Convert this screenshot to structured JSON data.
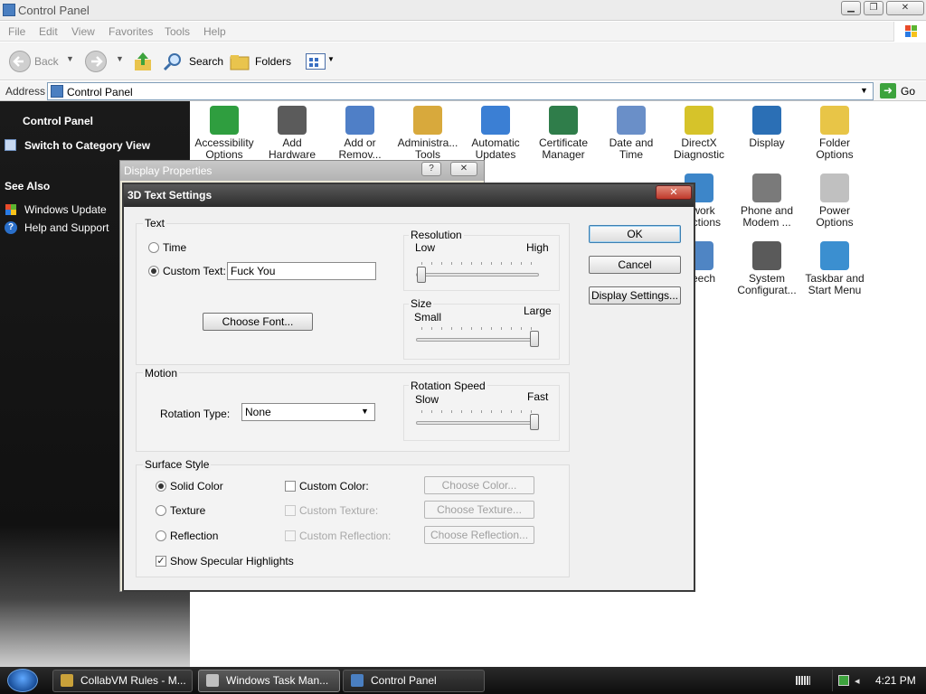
{
  "window": {
    "title": "Control Panel"
  },
  "menu": [
    "File",
    "Edit",
    "View",
    "Favorites",
    "Tools",
    "Help"
  ],
  "toolbar": {
    "back": "Back",
    "search": "Search",
    "folders": "Folders"
  },
  "address": {
    "label": "Address",
    "value": "Control Panel",
    "go": "Go"
  },
  "leftpanel": {
    "title": "Control Panel",
    "switch_view": "Switch to Category View",
    "see_also": "See Also",
    "links": [
      "Windows Update",
      "Help and Support"
    ]
  },
  "icons": {
    "row1": [
      {
        "l1": "Accessibility",
        "l2": "Options",
        "color": "#2f9e3f"
      },
      {
        "l1": "Add",
        "l2": "Hardware",
        "color": "#5b5b5b"
      },
      {
        "l1": "Add or",
        "l2": "Remov...",
        "color": "#4f7fc7"
      },
      {
        "l1": "Administra...",
        "l2": "Tools",
        "color": "#d8a93c"
      },
      {
        "l1": "Automatic",
        "l2": "Updates",
        "color": "#3b7fd4"
      },
      {
        "l1": "Certificate",
        "l2": "Manager",
        "color": "#2f7d4a"
      },
      {
        "l1": "Date and",
        "l2": "Time",
        "color": "#6a8fc8"
      },
      {
        "l1": "DirectX",
        "l2": "Diagnostic",
        "color": "#d6c32a"
      },
      {
        "l1": "Display",
        "l2": "",
        "color": "#2b6fb5"
      },
      {
        "l1": "Folder",
        "l2": "Options",
        "color": "#e8c547"
      }
    ],
    "row2": [
      {
        "l1": "...work",
        "l2": "...ections",
        "color": "#3d86c9"
      },
      {
        "l1": "Phone and",
        "l2": "Modem ...",
        "color": "#7a7a7a"
      },
      {
        "l1": "Power",
        "l2": "Options",
        "color": "#c0c0c0"
      }
    ],
    "row3": [
      {
        "l1": "...eech",
        "l2": "",
        "color": "#4f85c4"
      },
      {
        "l1": "System",
        "l2": "Configurat...",
        "color": "#5a5a5a"
      },
      {
        "l1": "Taskbar and",
        "l2": "Start Menu",
        "color": "#3b8fd0"
      }
    ]
  },
  "display_properties": {
    "title": "Display Properties"
  },
  "dialog": {
    "title": "3D Text Settings",
    "text_group": "Text",
    "time": "Time",
    "custom_text": "Custom Text:",
    "custom_text_value": "Fuck You",
    "choose_font": "Choose Font...",
    "resolution": "Resolution",
    "low": "Low",
    "high": "High",
    "resolution_level": 0.0,
    "size": "Size",
    "small": "Small",
    "large": "Large",
    "size_level": 1.0,
    "motion": "Motion",
    "rotation_type_label": "Rotation Type:",
    "rotation_type_value": "None",
    "rotation_speed": "Rotation Speed",
    "slow": "Slow",
    "fast": "Fast",
    "speed_level": 1.0,
    "surface_style": "Surface Style",
    "solid_color": "Solid Color",
    "texture": "Texture",
    "reflection": "Reflection",
    "custom_color": "Custom Color:",
    "custom_texture": "Custom Texture:",
    "custom_reflection": "Custom Reflection:",
    "choose_color": "Choose Color...",
    "choose_texture": "Choose Texture...",
    "choose_reflection": "Choose Reflection...",
    "show_specular": "Show Specular Highlights",
    "ok": "OK",
    "cancel": "Cancel",
    "display_settings": "Display Settings..."
  },
  "taskbar": {
    "items": [
      "CollabVM Rules - M...",
      "Windows Task Man...",
      "Control Panel"
    ],
    "clock": "4:21 PM"
  }
}
